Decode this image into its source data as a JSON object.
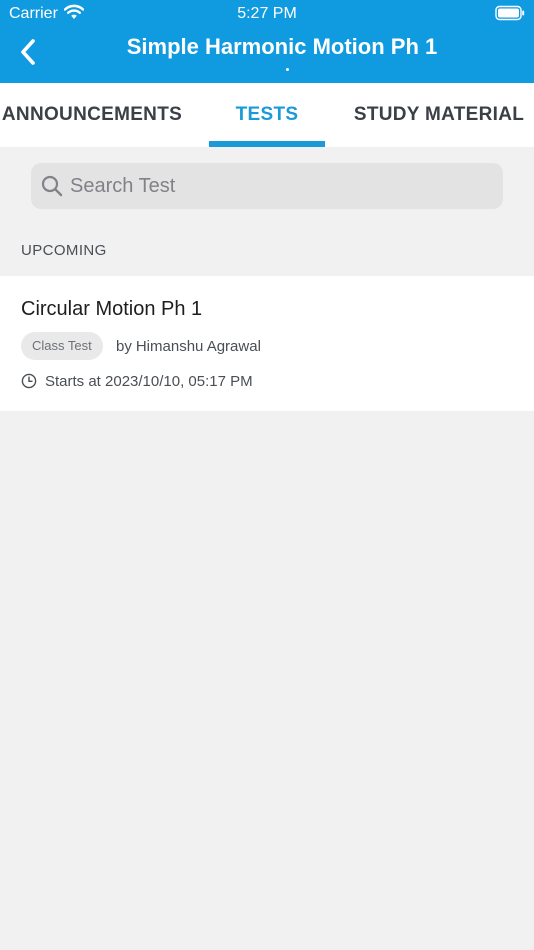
{
  "status_bar": {
    "carrier": "Carrier",
    "time": "5:27 PM"
  },
  "nav": {
    "title": "Simple Harmonic Motion Ph 1"
  },
  "tabs": [
    {
      "label": "ANNOUNCEMENTS",
      "active": false
    },
    {
      "label": "TESTS",
      "active": true
    },
    {
      "label": "STUDY MATERIAL",
      "active": false
    }
  ],
  "search": {
    "placeholder": "Search Test",
    "value": ""
  },
  "section": {
    "label": "UPCOMING"
  },
  "tests": [
    {
      "title": "Circular Motion Ph 1",
      "badge": "Class Test",
      "author_prefix": "by",
      "author": "Himanshu Agrawal",
      "starts": "Starts at 2023/10/10, 05:17 PM"
    }
  ],
  "colors": {
    "header": "#109ae0",
    "accent": "#1a9ad9",
    "background": "#f1f1f1"
  },
  "icons": {
    "back": "chevron-left-icon",
    "search": "search-icon",
    "clock": "clock-icon",
    "wifi": "wifi-icon",
    "battery": "battery-icon"
  }
}
